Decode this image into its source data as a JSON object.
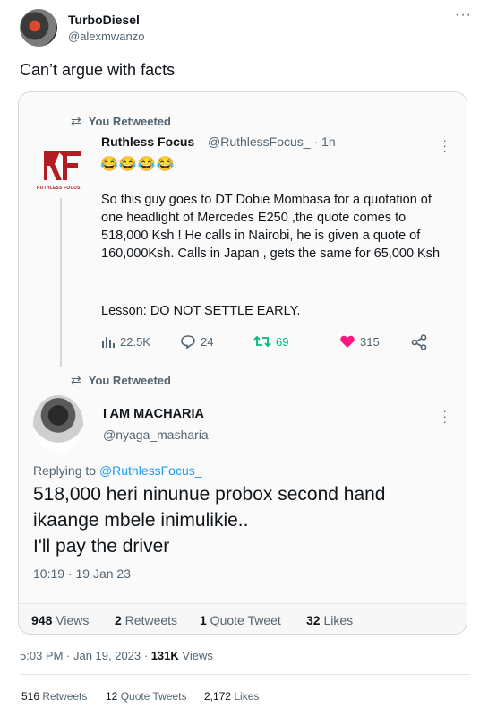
{
  "outer": {
    "name": "TurboDiesel",
    "handle": "@alexmwanzo",
    "more": "···",
    "text": "Can’t argue with facts",
    "timestamp": "5:03 PM · Jan 19, 2023 · ",
    "views_count": "131K",
    "views_label": " Views",
    "retweets": "516",
    "retweets_label": " Retweets",
    "quote_tweets": "12",
    "quote_tweets_label": " Quote Tweets",
    "likes": "2,172",
    "likes_label": " Likes"
  },
  "quoted": {
    "retweet_label_1": "You Retweeted",
    "tweet1": {
      "name": "Ruthless Focus",
      "handle": "@RuthlessFocus_ · 1h",
      "logo_text": "RUTHLESS FOCUS",
      "emoji": "😂😂😂😂",
      "body": "So this guy goes to DT Dobie Mombasa for a quotation of one headlight of Mercedes E250 ,the quote comes to 518,000 Ksh ! He calls in Nairobi, he is given a quote of 160,000Ksh. Calls in Japan , gets the same for 65,000 Ksh",
      "lesson": "Lesson: DO NOT SETTLE EARLY.",
      "views": "22.5K",
      "replies": "24",
      "retweets": "69",
      "likes": "315"
    },
    "retweet_label_2": "You Retweeted",
    "tweet2": {
      "name": "I AM MACHARIA",
      "handle": "@nyaga_masharia",
      "replying_to": "Replying to ",
      "replying_mention": "@RuthlessFocus_",
      "body_line1": "518,000 heri ninunue probox second hand",
      "body_line2": "ikaange mbele inimulikie..",
      "body_line3": "I'll pay the driver",
      "time": "10:19 · 19 Jan 23"
    },
    "stats": {
      "views": "948",
      "views_label": " Views",
      "retweets": "2",
      "retweets_label": " Retweets",
      "quote_tweets": "1",
      "quote_tweets_label": " Quote Tweet",
      "likes": "32",
      "likes_label": " Likes"
    }
  },
  "colors": {
    "accent_blue": "#1d9bf0",
    "retweet_green": "#00ba7c",
    "like_pink": "#f91880",
    "brand_red": "#b21d22"
  },
  "icons": [
    "retweet-icon",
    "views-icon",
    "reply-icon",
    "like-icon",
    "share-icon",
    "more-icon"
  ]
}
